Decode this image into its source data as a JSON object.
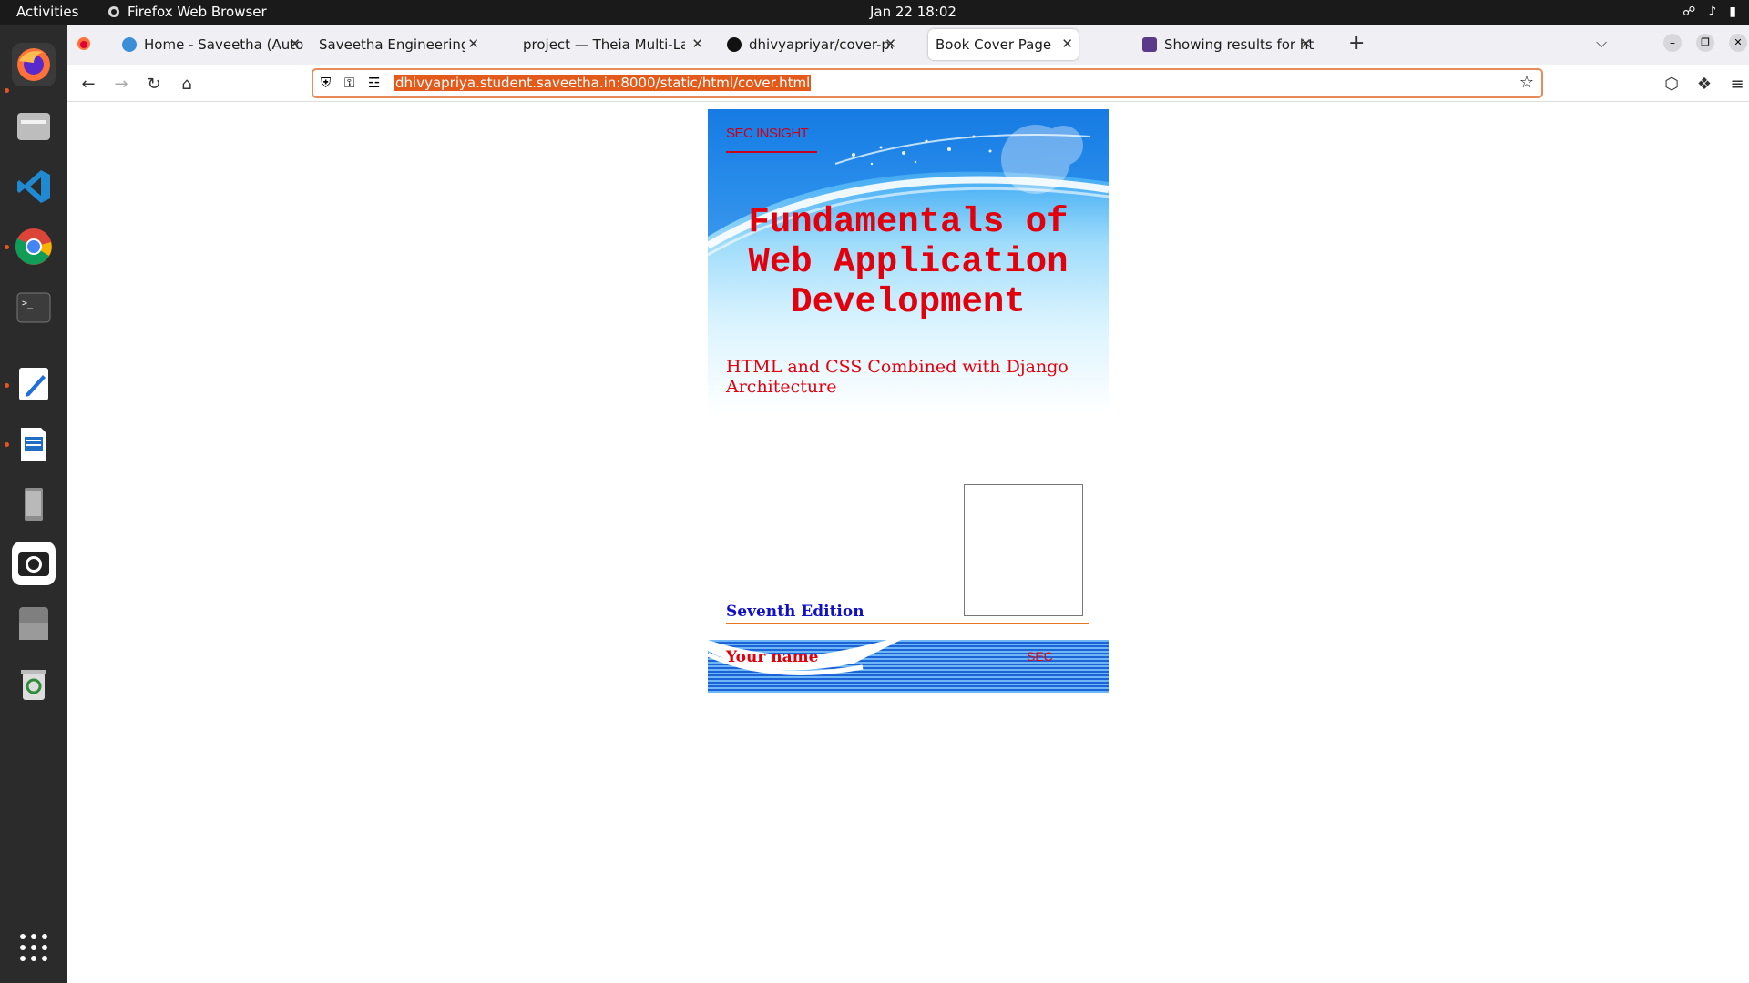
{
  "system": {
    "activities": "Activities",
    "app_name": "Firefox Web Browser",
    "clock": "Jan 22  18:02"
  },
  "tabs": [
    {
      "label": "Home - Saveetha (Autonomous)",
      "icon": "moodle-icon",
      "active": false
    },
    {
      "label": "Saveetha Engineering College",
      "icon": "none",
      "active": false
    },
    {
      "label": "project — Theia Multi-Language",
      "icon": "none",
      "active": false
    },
    {
      "label": "dhivyapriyar/cover-page-",
      "icon": "github-icon",
      "active": false
    },
    {
      "label": "Book Cover Page",
      "icon": "none",
      "active": true
    },
    {
      "label": "Showing results for http:",
      "icon": "search-icon",
      "active": false
    }
  ],
  "address_bar": {
    "url": "dhivyapriya.student.saveetha.in:8000/static/html/cover.html"
  },
  "cover": {
    "brand": "SEC INSIGHT",
    "title_lines": [
      "Fundamentals of",
      "Web Application",
      "Development"
    ],
    "subtitle": "HTML and CSS Combined with Django Architecture",
    "edition": "Seventh Edition",
    "author": "Your name",
    "publisher": "SEC"
  },
  "colors": {
    "title_red": "#e2000d",
    "edition_blue": "#1010c8",
    "accent_orange": "#e8761e",
    "url_highlight": "#e35a1a"
  }
}
